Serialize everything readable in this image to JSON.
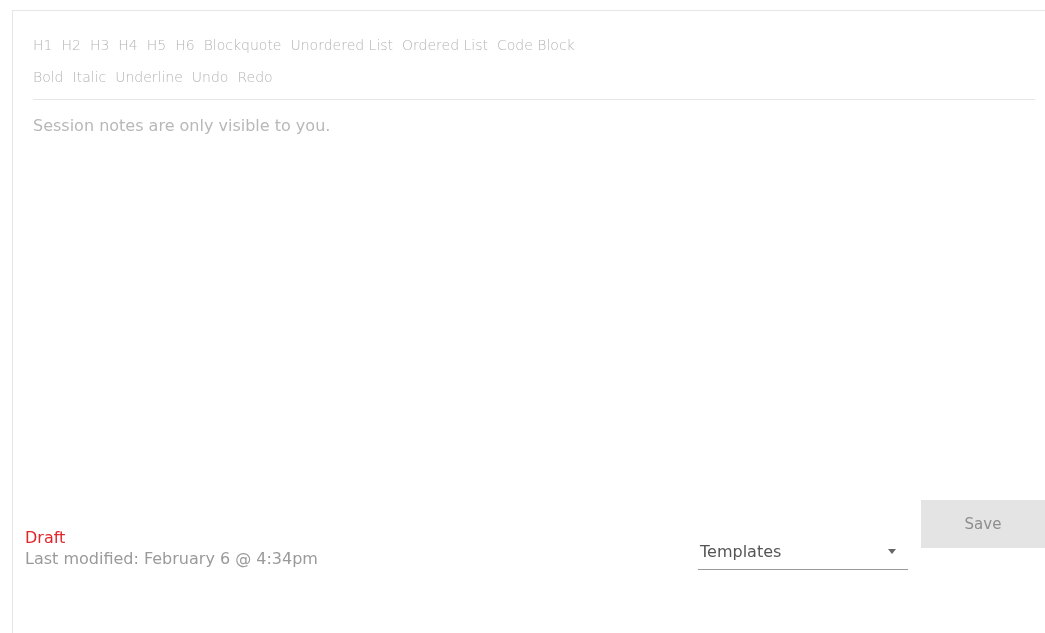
{
  "toolbar": {
    "block_buttons": [
      "H1",
      "H2",
      "H3",
      "H4",
      "H5",
      "H6",
      "Blockquote",
      "Unordered List",
      "Ordered List",
      "Code Block"
    ],
    "inline_buttons": [
      "Bold",
      "Italic",
      "Underline",
      "Undo",
      "Redo"
    ]
  },
  "editor": {
    "placeholder": "Session notes are only visible to you."
  },
  "footer": {
    "status": "Draft",
    "last_modified": "Last modified: February 6 @ 4:34pm",
    "templates": {
      "value": "Templates"
    },
    "save": {
      "label": "Save",
      "disabled": true
    }
  }
}
